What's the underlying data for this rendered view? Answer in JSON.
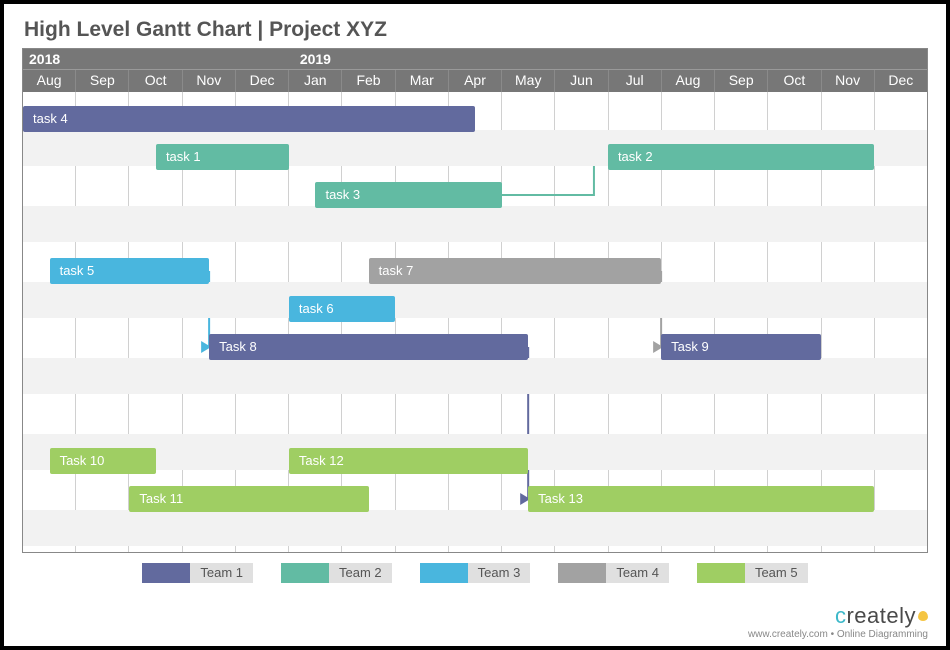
{
  "title": "High Level Gantt Chart | Project XYZ",
  "timeline": {
    "years": [
      {
        "label": "2018",
        "span_months": 5
      },
      {
        "label": "2019",
        "span_months": 12
      }
    ],
    "months": [
      "Aug",
      "Sep",
      "Oct",
      "Nov",
      "Dec",
      "Jan",
      "Feb",
      "Mar",
      "Apr",
      "May",
      "Jun",
      "Jul",
      "Aug",
      "Sep",
      "Oct",
      "Nov",
      "Dec"
    ]
  },
  "teams": {
    "team1": {
      "label": "Team 1",
      "color": "#626a9e"
    },
    "team2": {
      "label": "Team 2",
      "color": "#62bba3"
    },
    "team3": {
      "label": "Team 3",
      "color": "#49b6de"
    },
    "team4": {
      "label": "Team 4",
      "color": "#a2a2a2"
    },
    "team5": {
      "label": "Team 5",
      "color": "#9fce63"
    }
  },
  "tasks": {
    "task4": {
      "label": "task 4",
      "team": "team1",
      "row": 0,
      "start": 0.0,
      "end": 8.5
    },
    "task1": {
      "label": "task 1",
      "team": "team2",
      "row": 1,
      "start": 2.5,
      "end": 5.0
    },
    "task2": {
      "label": "task 2",
      "team": "team2",
      "row": 1,
      "start": 11.0,
      "end": 16.0
    },
    "task3": {
      "label": "task 3",
      "team": "team2",
      "row": 2,
      "start": 5.5,
      "end": 9.0
    },
    "task5": {
      "label": "task 5",
      "team": "team3",
      "row": 4,
      "start": 0.5,
      "end": 3.5
    },
    "task7": {
      "label": "task 7",
      "team": "team4",
      "row": 4,
      "start": 6.5,
      "end": 12.0
    },
    "task6": {
      "label": "task 6",
      "team": "team3",
      "row": 5,
      "start": 5.0,
      "end": 7.0
    },
    "task8": {
      "label": "Task 8",
      "team": "team1",
      "row": 6,
      "start": 3.5,
      "end": 9.5
    },
    "task9": {
      "label": "Task 9",
      "team": "team1",
      "row": 6,
      "start": 12.0,
      "end": 15.0
    },
    "task10": {
      "label": "Task 10",
      "team": "team5",
      "row": 9,
      "start": 0.5,
      "end": 2.5
    },
    "task12": {
      "label": "Task 12",
      "team": "team5",
      "row": 9,
      "start": 5.0,
      "end": 9.5
    },
    "task11": {
      "label": "Task 11",
      "team": "team5",
      "row": 10,
      "start": 2.0,
      "end": 6.5
    },
    "task13": {
      "label": "Task 13",
      "team": "team5",
      "row": 10,
      "start": 9.5,
      "end": 16.0
    }
  },
  "dependencies": [
    {
      "from": "task3",
      "to": "task2",
      "color": "#62bba3"
    },
    {
      "from": "task5",
      "to": "task8",
      "color": "#49b6de"
    },
    {
      "from": "task7",
      "to": "task9",
      "color": "#a2a2a2"
    },
    {
      "from": "task8",
      "to": "task13",
      "color": "#626a9e"
    }
  ],
  "footer": {
    "brand": "creately",
    "tagline": "www.creately.com • Online Diagramming"
  },
  "chart_data": {
    "type": "gantt",
    "title": "High Level Gantt Chart | Project XYZ",
    "x_axis": {
      "unit": "month",
      "start": "2018-08",
      "end": "2019-12",
      "tick_labels": [
        "Aug",
        "Sep",
        "Oct",
        "Nov",
        "Dec",
        "Jan",
        "Feb",
        "Mar",
        "Apr",
        "May",
        "Jun",
        "Jul",
        "Aug",
        "Sep",
        "Oct",
        "Nov",
        "Dec"
      ],
      "year_labels": [
        "2018",
        "2019"
      ]
    },
    "categories": [
      "Team 1",
      "Team 2",
      "Team 3",
      "Team 4",
      "Team 5"
    ],
    "series": [
      {
        "name": "task 4",
        "category": "Team 1",
        "start": "2018-08",
        "end": "2019-04"
      },
      {
        "name": "task 1",
        "category": "Team 2",
        "start": "2018-10",
        "end": "2018-12"
      },
      {
        "name": "task 2",
        "category": "Team 2",
        "start": "2019-07",
        "end": "2019-12"
      },
      {
        "name": "task 3",
        "category": "Team 2",
        "start": "2019-01",
        "end": "2019-05"
      },
      {
        "name": "task 5",
        "category": "Team 3",
        "start": "2018-08",
        "end": "2018-11"
      },
      {
        "name": "task 6",
        "category": "Team 3",
        "start": "2019-01",
        "end": "2019-03"
      },
      {
        "name": "task 7",
        "category": "Team 4",
        "start": "2019-02",
        "end": "2019-08"
      },
      {
        "name": "Task 8",
        "category": "Team 1",
        "start": "2018-11",
        "end": "2019-05"
      },
      {
        "name": "Task 9",
        "category": "Team 1",
        "start": "2019-08",
        "end": "2019-11"
      },
      {
        "name": "Task 10",
        "category": "Team 5",
        "start": "2018-08",
        "end": "2018-10"
      },
      {
        "name": "Task 11",
        "category": "Team 5",
        "start": "2018-10",
        "end": "2019-02"
      },
      {
        "name": "Task 12",
        "category": "Team 5",
        "start": "2019-01",
        "end": "2019-05"
      },
      {
        "name": "Task 13",
        "category": "Team 5",
        "start": "2019-05",
        "end": "2019-12"
      }
    ],
    "dependencies": [
      {
        "from": "task 3",
        "to": "task 2"
      },
      {
        "from": "task 5",
        "to": "Task 8"
      },
      {
        "from": "task 7",
        "to": "Task 9"
      },
      {
        "from": "Task 8",
        "to": "Task 13"
      }
    ],
    "legend": [
      "Team 1",
      "Team 2",
      "Team 3",
      "Team 4",
      "Team 5"
    ]
  }
}
